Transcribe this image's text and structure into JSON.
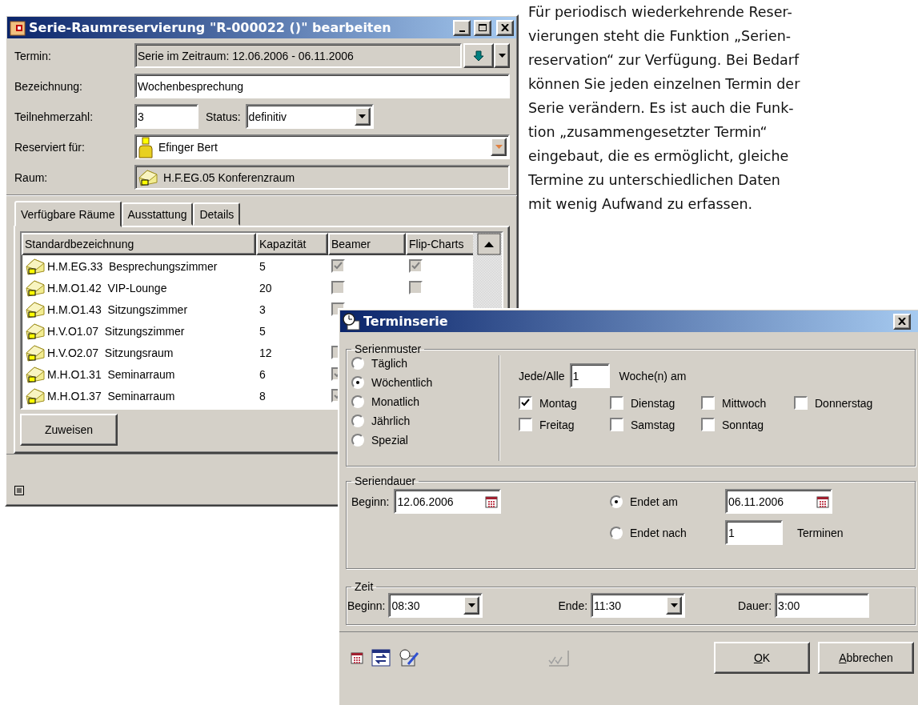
{
  "paragraph": "Für periodisch wiederkehrende Reser-\nvierungen steht die Funktion „Serien-\nreservation“ zur Verfügung. Bei Bedarf\nkönnen Sie jeden einzelnen Termin der\nSerie verändern. Es ist auch die Funk-\ntion „zusammengesetzter Termin“\neingebaut, die es ermöglicht, gleiche\nTermine zu unterschiedlichen Daten\nmit wenig Aufwand zu erfassen.",
  "edit_window": {
    "title": "Serie-Raumreservierung \"R-000022  ()\" bearbeiten",
    "termin": {
      "label": "Termin:",
      "value": "Serie im Zeitraum: 12.06.2006 - 06.11.2006"
    },
    "bezeichnung": {
      "label": "Bezeichnung:",
      "value": "Wochenbesprechung"
    },
    "teilnehmer": {
      "label": "Teilnehmerzahl:",
      "value": "3"
    },
    "status": {
      "label": "Status:",
      "value": "definitiv"
    },
    "reserviert": {
      "label": "Reserviert für:",
      "value": "Efinger Bert"
    },
    "raum": {
      "label": "Raum:",
      "value": "H.F.EG.05  Konferenzraum"
    },
    "tabs": [
      {
        "label": "Verfügbare Räume",
        "selected": true
      },
      {
        "label": "Ausstattung",
        "selected": false
      },
      {
        "label": "Details",
        "selected": false
      }
    ],
    "table": {
      "columns": [
        "Standardbezeichnung",
        "Kapazität",
        "Beamer",
        "Flip-Charts"
      ],
      "rows": [
        {
          "name": "H.M.EG.33  Besprechungszimmer",
          "capacity": "5",
          "beamer": true,
          "flip": true
        },
        {
          "name": "H.M.O1.42  VIP-Lounge",
          "capacity": "20",
          "beamer": false,
          "flip": false
        },
        {
          "name": "H.M.O1.43  Sitzungszimmer",
          "capacity": "3",
          "beamer": false
        },
        {
          "name": "H.V.O1.07  Sitzungszimmer",
          "capacity": "5"
        },
        {
          "name": "H.V.O2.07  Sitzungsraum",
          "capacity": "12",
          "beamer": false
        },
        {
          "name": "M.H.O1.31  Seminarraum",
          "capacity": "6",
          "beamer": true
        },
        {
          "name": "M.H.O1.37  Seminarraum",
          "capacity": "8",
          "beamer": true
        }
      ]
    },
    "assign_button": "Zuweisen"
  },
  "series_dialog": {
    "title": "Terminserie",
    "pattern": {
      "legend": "Serienmuster",
      "options": [
        {
          "label": "Täglich",
          "selected": false
        },
        {
          "label": "Wöchentlich",
          "selected": true
        },
        {
          "label": "Monatlich",
          "selected": false
        },
        {
          "label": "Jährlich",
          "selected": false
        },
        {
          "label": "Spezial",
          "selected": false
        }
      ],
      "interval_label": "Jede/Alle",
      "interval_value": "1",
      "interval_unit": "Woche(n) am",
      "days": [
        {
          "label": "Montag",
          "checked": true
        },
        {
          "label": "Dienstag",
          "checked": false
        },
        {
          "label": "Mittwoch",
          "checked": false
        },
        {
          "label": "Donnerstag",
          "checked": false
        },
        {
          "label": "Freitag",
          "checked": false
        },
        {
          "label": "Samstag",
          "checked": false
        },
        {
          "label": "Sonntag",
          "checked": false
        }
      ]
    },
    "duration": {
      "legend": "Seriendauer",
      "begin_label": "Beginn:",
      "begin_value": "12.06.2006",
      "end_options": [
        {
          "kind": "date",
          "label": "Endet am",
          "selected": true,
          "value": "06.11.2006"
        },
        {
          "kind": "count",
          "label": "Endet nach",
          "selected": false,
          "value": "1",
          "suffix": "Terminen"
        }
      ]
    },
    "time": {
      "legend": "Zeit",
      "begin_label": "Beginn:",
      "begin_value": "08:30",
      "end_label": "Ende:",
      "end_value": "11:30",
      "duration_label": "Dauer:",
      "duration_value": "3:00"
    },
    "buttons": [
      {
        "label": "OK",
        "underline_first": true
      },
      {
        "label": "Abbrechen",
        "underline_first": true
      }
    ]
  }
}
